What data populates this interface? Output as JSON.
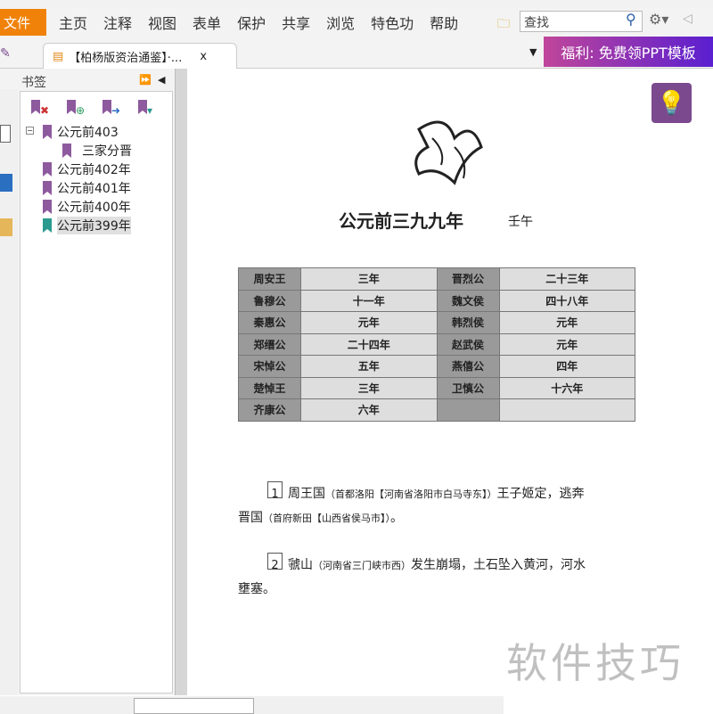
{
  "menu": {
    "file": "文件",
    "items": [
      "主页",
      "注释",
      "视图",
      "表单",
      "保护",
      "共享",
      "浏览",
      "特色功",
      "帮助"
    ],
    "search_placeholder": "查找"
  },
  "tab": {
    "title": "【柏杨版资治通鉴】·...",
    "close": "x"
  },
  "promo": "福利: 免费领PPT模板",
  "sidebar": {
    "title": "书签",
    "bookmarks": [
      {
        "label": "公元前403",
        "color": "#8e5a9e"
      },
      {
        "label": "三家分晋",
        "color": "#8e5a9e"
      },
      {
        "label": "公元前402年",
        "color": "#8e5a9e"
      },
      {
        "label": "公元前401年",
        "color": "#8e5a9e"
      },
      {
        "label": "公元前400年",
        "color": "#8e5a9e"
      },
      {
        "label": "公元前399年",
        "color": "#2a9a8e"
      }
    ]
  },
  "page": {
    "title": "公元前三九九年",
    "ganzhi": "壬午",
    "table": [
      [
        "周安王",
        "三年",
        "晋烈公",
        "二十三年"
      ],
      [
        "鲁穆公",
        "十一年",
        "魏文侯",
        "四十八年"
      ],
      [
        "秦惠公",
        "元年",
        "韩烈侯",
        "元年"
      ],
      [
        "郑缙公",
        "二十四年",
        "赵武侯",
        "元年"
      ],
      [
        "宋悼公",
        "五年",
        "燕僖公",
        "四年"
      ],
      [
        "楚悼王",
        "三年",
        "卫慎公",
        "十六年"
      ],
      [
        "齐康公",
        "六年",
        "",
        ""
      ]
    ],
    "p1": {
      "num": "1",
      "a": "周王国",
      "note1": "（首都洛阳【河南省洛阳市白马寺东】）",
      "b": "王子姬定，逃奔",
      "c": "晋国",
      "note2": "（首府新田【山西省侯马市】）",
      "d": "。"
    },
    "p2": {
      "num": "2",
      "a": "虢山",
      "note": "（河南省三门峡市西）",
      "b": "发生崩塌，土石坠入黄河，河水",
      "c": "壅塞。"
    }
  },
  "watermark": "软件技巧"
}
